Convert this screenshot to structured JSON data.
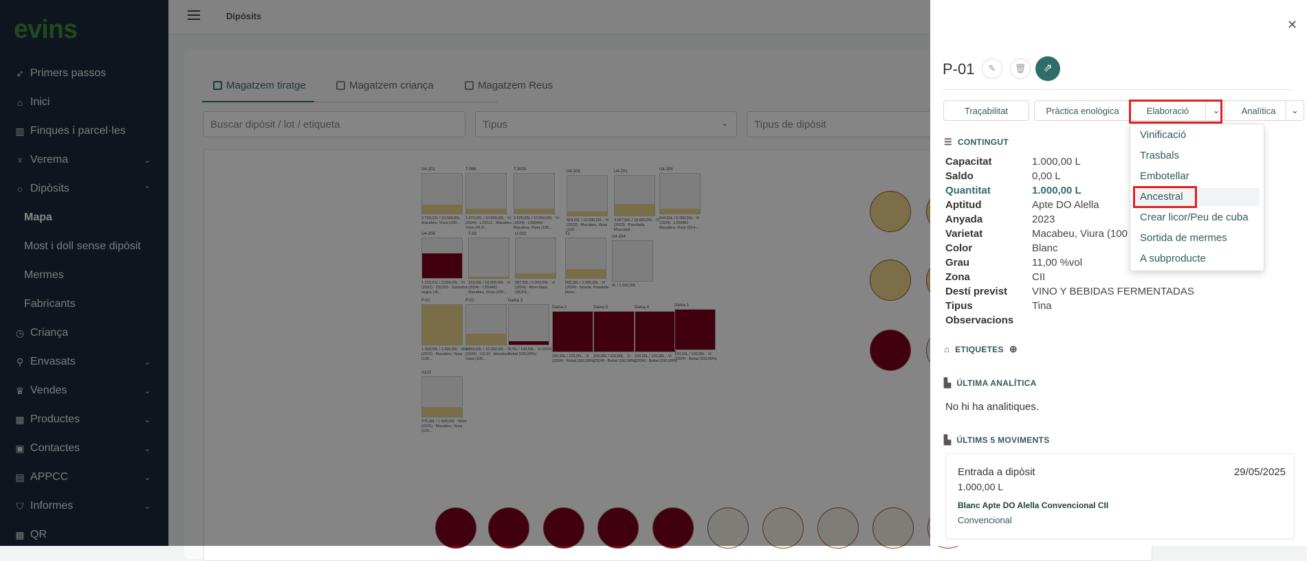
{
  "app": {
    "logo": "evins",
    "breadcrumb": "Dipòsits"
  },
  "sidebar": {
    "items": [
      {
        "label": "Primers passos",
        "icon": "rocket-icon"
      },
      {
        "label": "Inici",
        "icon": "home-icon"
      },
      {
        "label": "Finques i parcel·les",
        "icon": "map-icon"
      },
      {
        "label": "Verema",
        "icon": "trophy-icon"
      },
      {
        "label": "Dipòsits",
        "icon": "circle-icon"
      },
      {
        "label": "Criança",
        "icon": "clock-icon"
      },
      {
        "label": "Envasats",
        "icon": "bottle-icon"
      },
      {
        "label": "Vendes",
        "icon": "crown-icon"
      },
      {
        "label": "Productes",
        "icon": "grid-icon"
      },
      {
        "label": "Contactes",
        "icon": "contacts-icon"
      },
      {
        "label": "APPCC",
        "icon": "clipboard-icon"
      },
      {
        "label": "Informes",
        "icon": "shield-icon"
      },
      {
        "label": "QR",
        "icon": "qr-icon"
      }
    ],
    "sub_items": [
      "Mapa",
      "Most i doll sense dipòsit",
      "Mermes",
      "Fabricants"
    ]
  },
  "main": {
    "tabs": [
      "Magatzem tiratge",
      "Magatzem criança",
      "Magatzem Reus"
    ],
    "search_placeholder": "Buscar dipòsit / lot / etiqueta",
    "tipus_placeholder": "Tipus",
    "tipus_diposit_placeholder": "Tipus de dipòsit"
  },
  "tanks": [
    {
      "name": "U4-202",
      "info": "3.733,22L / 10.000,00L · Macabeu, Viura (100...",
      "fill": 0.22,
      "color": "#e8d48a"
    },
    {
      "name": "T-068",
      "info": "1.273,00L / 10.000,00L · Vi (2024) · L20212 · Macabeu, Viura (41,6...",
      "fill": 0.12,
      "color": "#e8d48a"
    },
    {
      "name": "T.3000",
      "info": "3.625,00L / 10.000,00L · Vi (2024) · L955464 · Macabeu, Viura (100...",
      "fill": 0.12,
      "color": "#e8d48a"
    },
    {
      "name": "U4-203",
      "info": "924,00L / 10.000,00L · Vi (2023) · Macabeu, Viura (100...",
      "fill": 0.1,
      "color": "#e8d48a"
    },
    {
      "name": "U4-201",
      "info": "3.587,50L / 10.000,00L · Vi (2023) · Parellada, Moscatell...",
      "fill": 0.3,
      "color": "#e8d48a"
    },
    {
      "name": "U4-205",
      "info": "644,50L / 5.000,00L · Vi (2024) · L202402 · Macabeu, Viura (33,4...",
      "fill": 0.12,
      "color": "#e8d48a"
    },
    {
      "name": "U4-206",
      "info": "1.220,01L / 2.000,00L · Vi (2023) · 231203 · Garnatxa negra, Ull...",
      "fill": 0.62,
      "color": "#7b0020"
    },
    {
      "name": "T-83",
      "info": "318,00L / 10.000,00L · Vi (2024) · L250402 · Macabeu, Viura (100...",
      "fill": 0.04,
      "color": "#e8d48a"
    },
    {
      "name": "U-002",
      "info": "587,50L / 5.000,00L · Vi (2024) · Airen blanc (48,5%...",
      "fill": 0.12,
      "color": "#e8d48a"
    },
    {
      "name": "T1",
      "info": "500,00L / 2.000,00L · Vi (2024) · Sorelle, Parelada blanc...",
      "fill": 0.22,
      "color": "#e8d48a"
    },
    {
      "name": "U4-204",
      "info": "0L / 1.000,00L",
      "fill": 0,
      "color": "#e8d48a"
    },
    {
      "name": "P-01",
      "info": "1.000,00L / 1.000,00L · Most (2023) · Macabeu, Viura (100...",
      "fill": 1.0,
      "color": "#e8d48a"
    },
    {
      "name": "P-02",
      "info": "2.650,00L / 10.000,00L · Vi (2024) · UV-23 · Macabeu, Viura (100...",
      "fill": 0.27,
      "color": "#e8d48a"
    },
    {
      "name": "Dama 3",
      "info": "7,75L / 100,00L · Vi (2024) · Bobal (100,00%)",
      "fill": 0.08,
      "color": "#7b0020"
    },
    {
      "name": "Dama 2",
      "info": "100,00L / 100,00L · Vi (2024) · Bobal (100,00%)",
      "fill": 1.0,
      "color": "#7b0020"
    },
    {
      "name": "Dama 5",
      "info": "100,00L / 100,00L · Vi (2024) · Bobal (100,00%)",
      "fill": 1.0,
      "color": "#7b0020"
    },
    {
      "name": "Dama 4",
      "info": "100,00L / 100,00L · Vi (2024) · Bobal (100,00%)",
      "fill": 1.0,
      "color": "#7b0020"
    },
    {
      "name": "Dama 1",
      "info": "100,00L / 100,00L · Vi (2024) · Bobal (100,00%)",
      "fill": 1.0,
      "color": "#7b0020"
    },
    {
      "name": "A123",
      "info": "375,00L / 1.500,00L · Most (2025) · Macabeu, Viura (100...",
      "fill": 0.25,
      "color": "#e8d48a"
    }
  ],
  "drawer": {
    "title": "P-01",
    "actions": {
      "tracabilitat": "Traçabilitat",
      "practica": "Pràctica enològica",
      "elaboracio": "Elaboració",
      "analitica": "Analítica"
    },
    "menu": [
      "Vinificació",
      "Trasbals",
      "Embotellar",
      "Ancestral",
      "Crear licor/Peu de cuba",
      "Sortida de mermes",
      "A subproducte"
    ],
    "sections": {
      "contingut": "CONTINGUT",
      "etiquetes": "ETIQUETES",
      "ultima_analitica": "ÚLTIMA ANALÍTICA",
      "ultims_moviments": "ÚLTIMS 5 MOVIMENTS"
    },
    "fields": [
      {
        "k": "Capacitat",
        "v": "1.000,00 L"
      },
      {
        "k": "Saldo",
        "v": "0,00 L"
      },
      {
        "k": "Quantitat",
        "v": "1.000,00 L"
      },
      {
        "k": "Aptitud",
        "v": "Apte DO Alella"
      },
      {
        "k": "Anyada",
        "v": "2023"
      },
      {
        "k": "Varietat",
        "v": "Macabeu, Viura (100"
      },
      {
        "k": "Color",
        "v": "Blanc"
      },
      {
        "k": "Grau",
        "v": "11,00 %vol"
      },
      {
        "k": "Zona",
        "v": "CII"
      },
      {
        "k": "Destí previst",
        "v": "VINO Y BEBIDAS FERMENTADAS"
      },
      {
        "k": "Tipus",
        "v": "Tina"
      },
      {
        "k": "Observacions",
        "v": ""
      }
    ],
    "no_analitiques": "No hi ha analitiques.",
    "movement": {
      "type": "Entrada a dipòsit",
      "date": "29/05/2025",
      "qty": "1.000,00 L",
      "product": "Blanc Apte DO Alella Convencional CII",
      "category": "Convencional"
    }
  }
}
